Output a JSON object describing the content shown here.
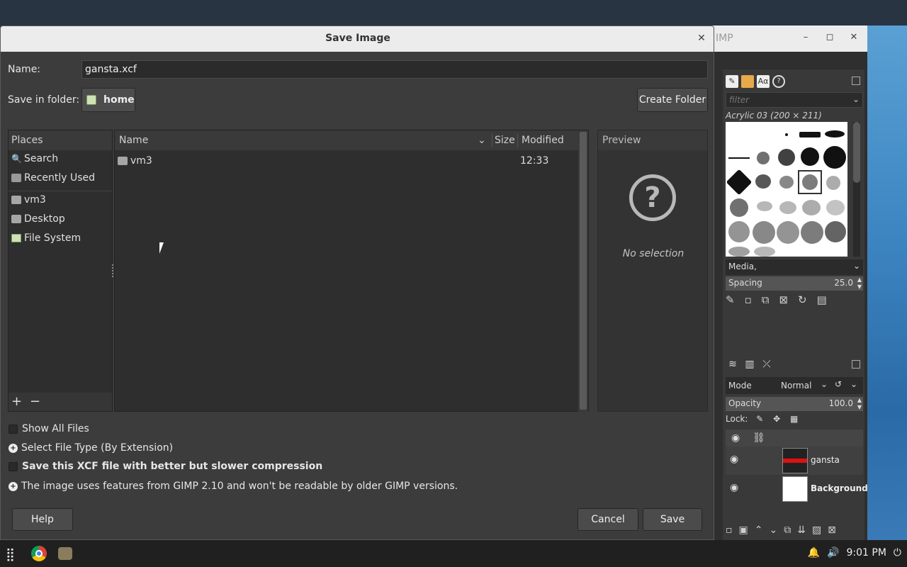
{
  "gimp_window": {
    "title": "IMP",
    "minimize": "–",
    "maximize": "◻",
    "close": "✕",
    "brushes": {
      "filter_placeholder": "filter",
      "current_brush": "Acrylic 03 (200 × 211)",
      "tag_select": "Media,",
      "spacing_label": "Spacing",
      "spacing_value": "25.0"
    },
    "layers": {
      "mode_label": "Mode",
      "mode_value": "Normal",
      "opacity_label": "Opacity",
      "opacity_value": "100.0",
      "lock_label": "Lock:",
      "items": [
        {
          "name": "gansta",
          "visible": true
        },
        {
          "name": "Background",
          "visible": true
        }
      ]
    }
  },
  "dialog": {
    "title": "Save Image",
    "name_label": "Name:",
    "name_value": "gansta.xcf",
    "folder_label": "Save in folder:",
    "folder_value": "home",
    "create_folder": "Create Folder",
    "places": {
      "header": "Places",
      "items": [
        {
          "label": "Search",
          "icon": "search-icon"
        },
        {
          "label": "Recently Used",
          "icon": "recent-icon"
        },
        {
          "label": "vm3",
          "icon": "folder-icon"
        },
        {
          "label": "Desktop",
          "icon": "folder-icon"
        },
        {
          "label": "File System",
          "icon": "drive-icon"
        }
      ],
      "add": "+",
      "remove": "−"
    },
    "files": {
      "columns": [
        "Name",
        "Size",
        "Modified"
      ],
      "rows": [
        {
          "name": "vm3",
          "size": "",
          "modified": "12:33"
        }
      ]
    },
    "preview": {
      "header": "Preview",
      "empty": "No selection"
    },
    "options": {
      "show_all_files": "Show All Files",
      "select_file_type": "Select File Type (By Extension)",
      "better_compression": "Save this XCF file with better but slower compression",
      "compat_notice": "The image uses features from GIMP 2.10 and won't be readable by older GIMP versions."
    },
    "buttons": {
      "help": "Help",
      "cancel": "Cancel",
      "save": "Save"
    }
  },
  "taskbar": {
    "time": "9:01 PM"
  }
}
